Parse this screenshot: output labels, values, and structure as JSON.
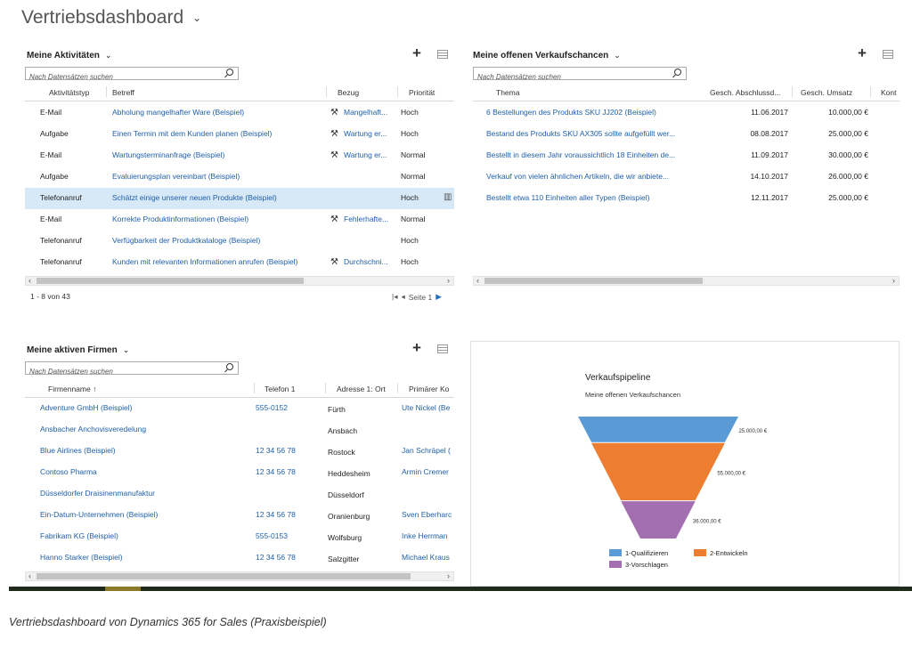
{
  "page": {
    "title": "Vertriebsdashboard",
    "caption": "Vertriebsdashboard von Dynamics 365 for Sales (Praxisbeispiel)"
  },
  "activities": {
    "title": "Meine Aktivitäten",
    "search_placeholder": "Nach Datensätzen suchen",
    "columns": [
      "Aktivitätstyp",
      "Betreff",
      "Bezug",
      "Priorität"
    ],
    "rows": [
      {
        "type": "E-Mail",
        "subject": "Abholung mangelhafter Ware (Beispiel)",
        "ref": "Mangelhaft...",
        "priority": "Hoch"
      },
      {
        "type": "Aufgabe",
        "subject": "Einen Termin mit dem Kunden planen (Beispiel)",
        "ref": "Wartung er...",
        "priority": "Hoch"
      },
      {
        "type": "E-Mail",
        "subject": "Wartungsterminanfrage (Beispiel)",
        "ref": "Wartung er...",
        "priority": "Normal"
      },
      {
        "type": "Aufgabe",
        "subject": "Evaluierungsplan vereinbart (Beispiel)",
        "ref": "",
        "priority": "Normal"
      },
      {
        "type": "Telefonanruf",
        "subject": "Schätzt einige unserer neuen Produkte (Beispiel)",
        "ref": "",
        "priority": "Hoch"
      },
      {
        "type": "E-Mail",
        "subject": "Korrekte Produktinformationen (Beispiel)",
        "ref": "Fehlerhafte...",
        "priority": "Normal"
      },
      {
        "type": "Telefonanruf",
        "subject": "Verfügbarkeit der Produktkataloge (Beispiel)",
        "ref": "",
        "priority": "Hoch"
      },
      {
        "type": "Telefonanruf",
        "subject": "Kunden mit relevanten Informationen anrufen (Beispiel)",
        "ref": "Durchschni...",
        "priority": "Hoch"
      }
    ],
    "footer_count": "1 - 8  von 43",
    "pager_label": "Seite 1"
  },
  "opportunities": {
    "title": "Meine offenen Verkaufschancen",
    "search_placeholder": "Nach Datensätzen suchen",
    "columns": [
      "Thema",
      "Gesch. Abschlussd...",
      "Gesch. Umsatz",
      "Kont"
    ],
    "rows": [
      {
        "topic": "6 Bestellungen des Produkts SKU JJ202 (Beispiel)",
        "date": "11.06.2017",
        "revenue": "10.000,00 €"
      },
      {
        "topic": "Bestand des Produkts SKU AX305 sollte aufgefüllt wer...",
        "date": "08.08.2017",
        "revenue": "25.000,00 €"
      },
      {
        "topic": "Bestellt in diesem Jahr voraussichtlich 18 Einheiten de...",
        "date": "11.09.2017",
        "revenue": "30.000,00 €"
      },
      {
        "topic": "Verkauf von vielen ähnlichen Artikeln, die wir anbiete...",
        "date": "14.10.2017",
        "revenue": "26.000,00 €"
      },
      {
        "topic": "Bestellt etwa 110 Einheiten aller Typen (Beispiel)",
        "date": "12.11.2017",
        "revenue": "25.000,00 €"
      }
    ]
  },
  "accounts": {
    "title": "Meine aktiven Firmen",
    "search_placeholder": "Nach Datensätzen suchen",
    "columns": [
      "Firmenname ↑",
      "Telefon 1",
      "Adresse 1: Ort",
      "Primärer Ko"
    ],
    "rows": [
      {
        "name": "Adventure GmbH (Beispiel)",
        "phone": "555-0152",
        "city": "Fürth",
        "contact": "Ute Nickel (Be"
      },
      {
        "name": "Ansbacher Anchovisveredelung",
        "phone": "",
        "city": "Ansbach",
        "contact": ""
      },
      {
        "name": "Blue Airlines (Beispiel)",
        "phone": "12 34 56 78",
        "city": "Rostock",
        "contact": "Jan Schräpel ("
      },
      {
        "name": "Contoso Pharma",
        "phone": "12 34 56 78",
        "city": "Heddesheim",
        "contact": "Armin Cremer"
      },
      {
        "name": "Düsseldorfer Draisinenmanufaktur",
        "phone": "",
        "city": "Düsseldorf",
        "contact": ""
      },
      {
        "name": "Ein-Datum-Unternehmen (Beispiel)",
        "phone": "12 34 56 78",
        "city": "Oranienburg",
        "contact": "Sven Eberharc"
      },
      {
        "name": "Fabrikam KG (Beispiel)",
        "phone": "555-0153",
        "city": "Wolfsburg",
        "contact": "Inke Herrman"
      },
      {
        "name": "Hanno Starker (Beispiel)",
        "phone": "12 34 56 78",
        "city": "Salzgitter",
        "contact": "Michael Kraus"
      }
    ]
  },
  "chart_data": {
    "type": "funnel",
    "title": "Verkaufspipeline",
    "subtitle": "Meine offenen Verkaufschancen",
    "categories": [
      "1-Qualifizieren",
      "2-Entwickeln",
      "3-Vorschlagen"
    ],
    "values": [
      25000,
      55000,
      36000
    ],
    "value_labels": [
      "25.000,00 €",
      "55.000,00 €",
      "36.000,00 €"
    ],
    "colors": [
      "#5b9bd5",
      "#ed7d31",
      "#a36fb1"
    ],
    "legend_position": "bottom"
  }
}
